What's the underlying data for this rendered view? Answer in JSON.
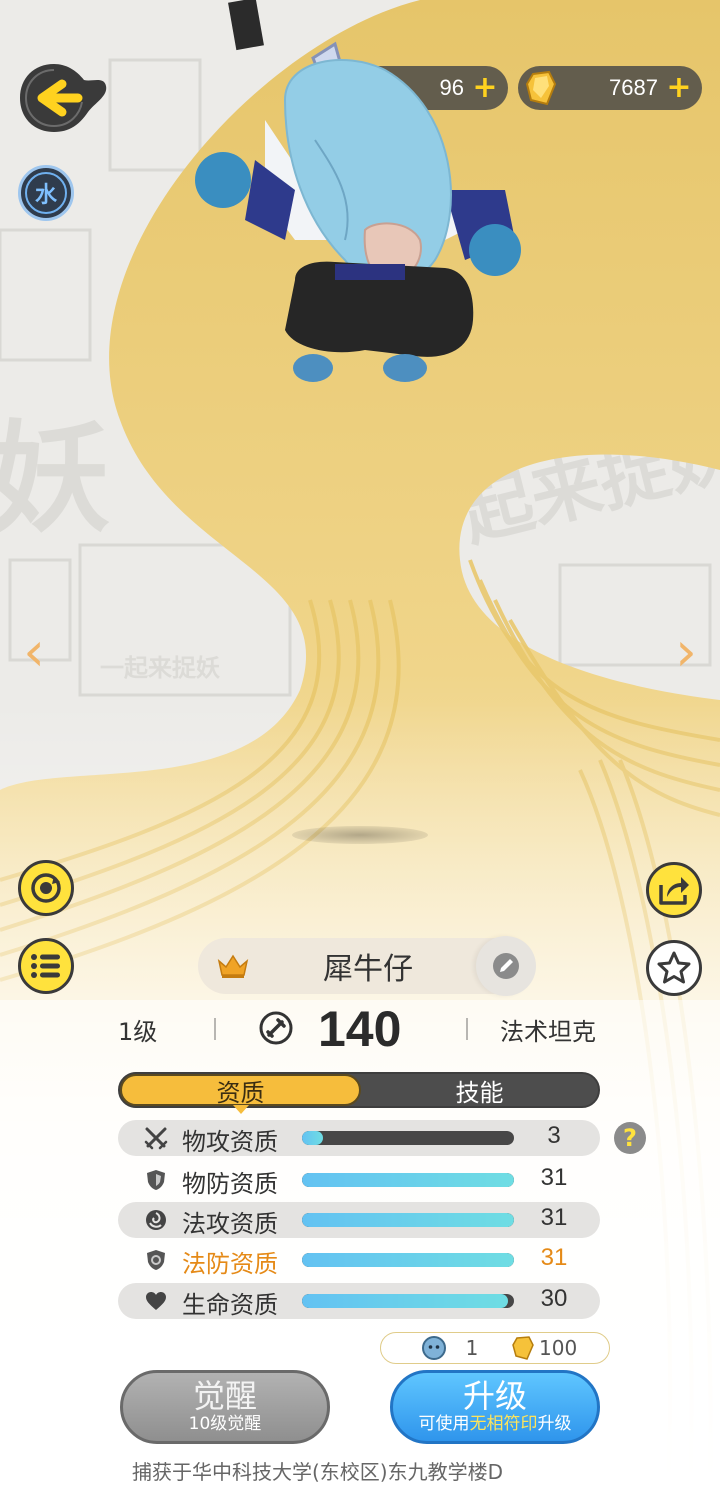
{
  "header": {
    "element_badge": "水",
    "currency_pet": {
      "icon": "pet-token-icon",
      "value": "96"
    },
    "currency_gold": {
      "icon": "gold-crystal-icon",
      "value": "7687"
    },
    "plus": "+"
  },
  "pet": {
    "name": "犀牛仔",
    "level": "1级",
    "power": "140",
    "role": "法术坦克"
  },
  "nav": {
    "prev": "‹",
    "next": "›"
  },
  "tabs": [
    {
      "label": "资质",
      "active": true
    },
    {
      "label": "技能",
      "active": false
    }
  ],
  "stats": [
    {
      "label": "物攻资质",
      "value": "3",
      "fill": 0.1,
      "icon": "crossed-swords-icon"
    },
    {
      "label": "物防资质",
      "value": "31",
      "fill": 1.0,
      "icon": "shield-icon"
    },
    {
      "label": "法攻资质",
      "value": "31",
      "fill": 1.0,
      "icon": "magic-orb-icon"
    },
    {
      "label": "法防资质",
      "value": "31",
      "fill": 1.0,
      "icon": "magic-shield-icon",
      "highlight": true
    },
    {
      "label": "生命资质",
      "value": "30",
      "fill": 0.97,
      "icon": "heart-icon"
    }
  ],
  "help": "?",
  "cost": {
    "pet_token": "1",
    "gold": "100"
  },
  "buttons": {
    "awaken": {
      "main": "觉醒",
      "sub": "10级觉醒"
    },
    "upgrade": {
      "main": "升级",
      "sub_prefix": "可使用",
      "sub_highlight": "无相符印",
      "sub_suffix": "升级"
    }
  },
  "footer": "捕获于华中科技大学(东校区)东九教学楼D",
  "colors": {
    "accent_yellow": "#ffe23d",
    "tab_active": "#f6bd3c",
    "bar_fill": "#63c2f2",
    "upgrade_blue": "#2f95ec",
    "highlight_orange": "#e58a17"
  }
}
